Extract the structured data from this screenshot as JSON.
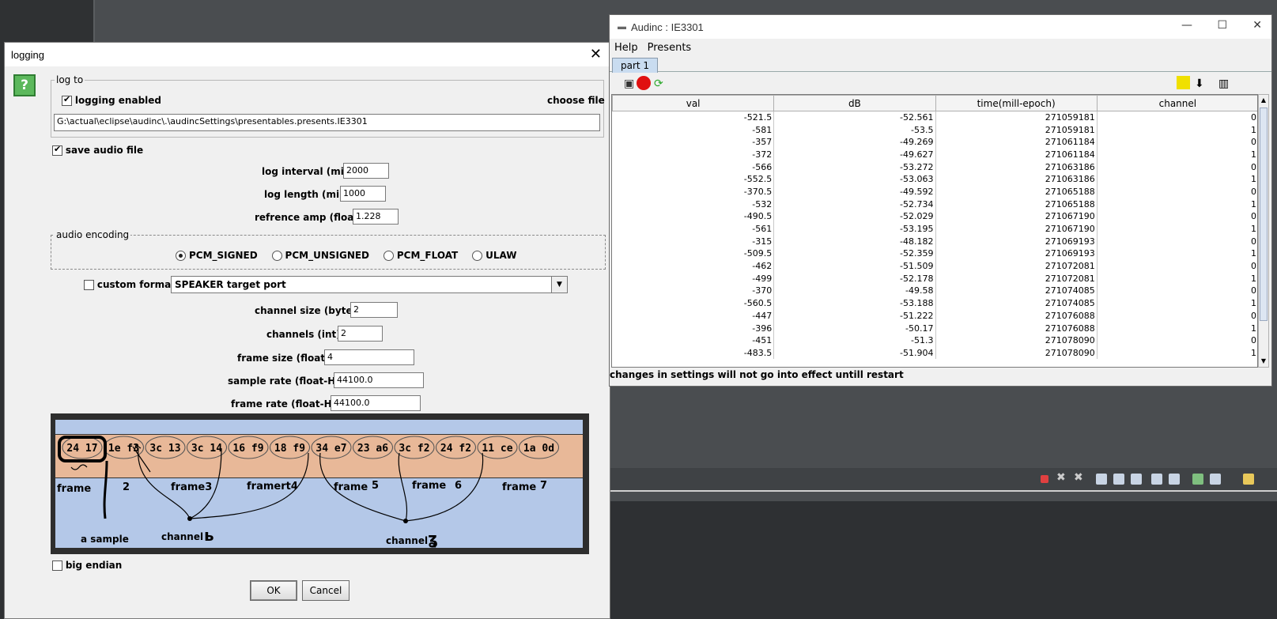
{
  "logging_dialog": {
    "title": "logging",
    "help_label": "?",
    "close_label": "✕",
    "log_to": {
      "legend": "log to",
      "logging_enabled_label": "logging enabled",
      "choose_file_label": "choose file",
      "path": "G:\\actual\\eclipse\\audinc\\.\\audincSettings\\presentables.presents.IE3301"
    },
    "save_audio_label": "save audio file",
    "log_interval": {
      "label": "log interval (mil):",
      "value": "2000"
    },
    "log_length": {
      "label": "log length (mil):",
      "value": "1000"
    },
    "reference_amp": {
      "label": "refrence amp (float):",
      "value": "1.228"
    },
    "encoding": {
      "legend": "audio encoding",
      "options": [
        "PCM_SIGNED",
        "PCM_UNSIGNED",
        "PCM_FLOAT",
        "ULAW"
      ],
      "selected": "PCM_SIGNED"
    },
    "custom_format_label": "custom format",
    "port_select": "SPEAKER target port",
    "channel_size": {
      "label": "channel size (bytes):",
      "value": "2"
    },
    "channels": {
      "label": "channels (int):",
      "value": "2"
    },
    "frame_size": {
      "label": "frame size  (float):",
      "value": "4"
    },
    "sample_rate": {
      "label": "sample rate (float-Hz):",
      "value": "44100.0"
    },
    "frame_rate": {
      "label": "frame rate (float-Hz):",
      "value": "44100.0"
    },
    "diagram": {
      "hex_bytes": [
        "24",
        "17",
        "1e",
        "f3",
        "3c",
        "13",
        "3c",
        "14",
        "16",
        "f9",
        "18",
        "f9",
        "34",
        "e7",
        "23",
        "a6",
        "3c",
        "f2",
        "24",
        "f2",
        "11",
        "ce",
        "1a",
        "0d"
      ],
      "frame_labels": [
        "frame",
        "2",
        "frame3",
        "framert4",
        "frame",
        "5",
        "frame",
        "6",
        "frame",
        "7"
      ],
      "a_sample": "a sample",
      "channel_a": "channel",
      "channel_b": "channel"
    },
    "big_endian_label": "big endian",
    "ok_label": "OK",
    "cancel_label": "Cancel"
  },
  "audinc_window": {
    "title": "Audinc : IE3301",
    "menus": [
      "Help",
      "Presents"
    ],
    "tab": "part 1",
    "columns": [
      "val",
      "dB",
      "time(mill-epoch)",
      "channel"
    ],
    "rows": [
      [
        "-521.5",
        "-52.561",
        "271059181",
        "0"
      ],
      [
        "-581",
        "-53.5",
        "271059181",
        "1"
      ],
      [
        "-357",
        "-49.269",
        "271061184",
        "0"
      ],
      [
        "-372",
        "-49.627",
        "271061184",
        "1"
      ],
      [
        "-566",
        "-53.272",
        "271063186",
        "0"
      ],
      [
        "-552.5",
        "-53.063",
        "271063186",
        "1"
      ],
      [
        "-370.5",
        "-49.592",
        "271065188",
        "0"
      ],
      [
        "-532",
        "-52.734",
        "271065188",
        "1"
      ],
      [
        "-490.5",
        "-52.029",
        "271067190",
        "0"
      ],
      [
        "-561",
        "-53.195",
        "271067190",
        "1"
      ],
      [
        "-315",
        "-48.182",
        "271069193",
        "0"
      ],
      [
        "-509.5",
        "-52.359",
        "271069193",
        "1"
      ],
      [
        "-462",
        "-51.509",
        "271072081",
        "0"
      ],
      [
        "-499",
        "-52.178",
        "271072081",
        "1"
      ],
      [
        "-370",
        "-49.58",
        "271074085",
        "0"
      ],
      [
        "-560.5",
        "-53.188",
        "271074085",
        "1"
      ],
      [
        "-447",
        "-51.222",
        "271076088",
        "0"
      ],
      [
        "-396",
        "-50.17",
        "271076088",
        "1"
      ],
      [
        "-451",
        "-51.3",
        "271078090",
        "0"
      ],
      [
        "-483.5",
        "-51.904",
        "271078090",
        "1"
      ]
    ],
    "status": "changes in settings will not go into effect untill restart"
  }
}
